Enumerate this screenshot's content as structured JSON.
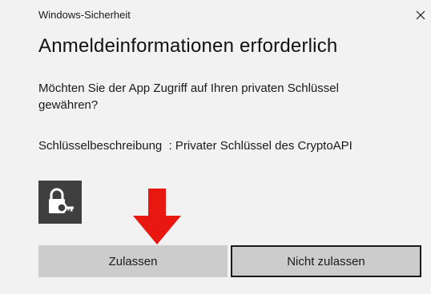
{
  "window": {
    "title": "Windows-Sicherheit",
    "close_glyph": "×"
  },
  "dialog": {
    "heading": "Anmeldeinformationen erforderlich",
    "question": "Möchten Sie der App Zugriff auf Ihren privaten Schlüssel gewähren?",
    "key_description": "Schlüsselbeschreibung  : Privater Schlüssel des CryptoAPI",
    "icon": "lock-key-icon"
  },
  "buttons": {
    "allow_label": "Zulassen",
    "deny_label": "Nicht zulassen"
  },
  "annotation": {
    "icon": "red-arrow-down-icon",
    "color": "#e8170f"
  },
  "colors": {
    "dialog_background": "#f2f2f2",
    "button_background": "#cccccc",
    "icon_tile": "#3f3f3f",
    "focus_border": "#1a1a1a"
  }
}
